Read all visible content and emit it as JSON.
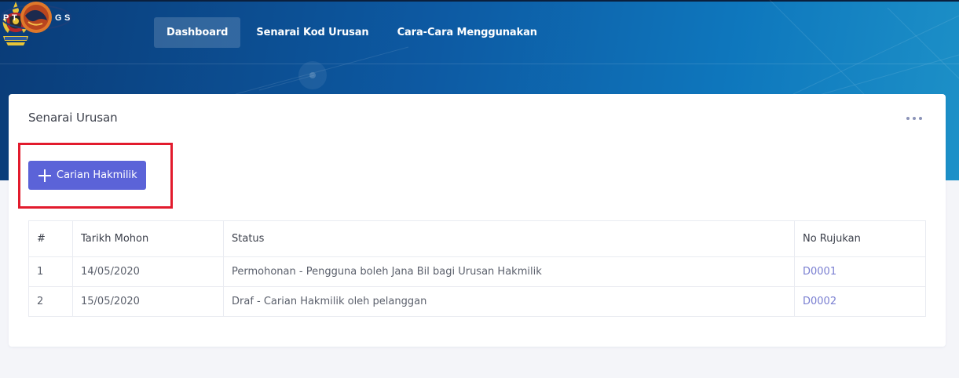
{
  "header": {
    "logo_text": "PTGS",
    "nav": [
      {
        "label": "Dashboard",
        "active": true
      },
      {
        "label": "Senarai Kod Urusan",
        "active": false
      },
      {
        "label": "Cara-Cara Menggunakan",
        "active": false
      }
    ]
  },
  "card": {
    "title": "Senarai Urusan",
    "menu_icon": "more-horizontal-icon",
    "primary_button": {
      "label": "Carian Hakmilik",
      "icon": "plus-icon"
    }
  },
  "table": {
    "columns": [
      "#",
      "Tarikh Mohon",
      "Status",
      "No Rujukan"
    ],
    "rows": [
      {
        "no": "1",
        "date": "14/05/2020",
        "status": "Permohonan - Pengguna boleh Jana Bil bagi Urusan Hakmilik",
        "ref": "D0001"
      },
      {
        "no": "2",
        "date": "15/05/2020",
        "status": "Draf - Carian Hakmilik oleh pelanggan",
        "ref": "D0002"
      }
    ]
  },
  "colors": {
    "accent": "#5b63d8",
    "highlight": "#e21b2d",
    "link": "#7a7fd1",
    "header_gradient_start": "#0a3c78",
    "header_gradient_end": "#1d91c8"
  }
}
